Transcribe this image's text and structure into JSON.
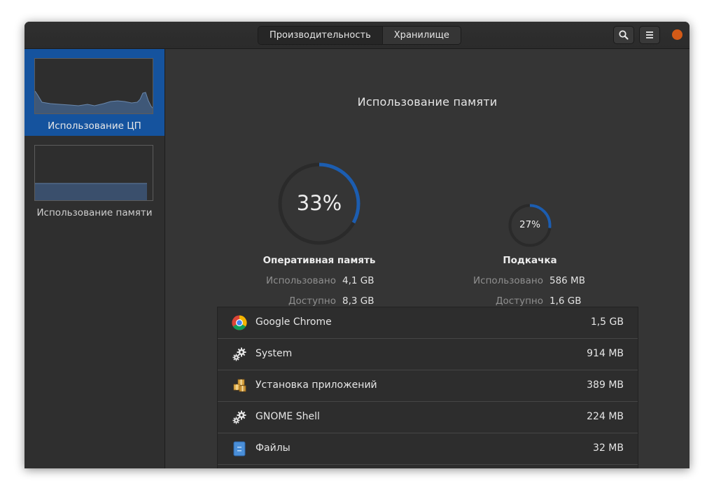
{
  "header": {
    "tabs": [
      {
        "label": "Производительность"
      },
      {
        "label": "Хранилище"
      }
    ],
    "icons": {
      "search": "search-icon",
      "menu": "hamburger-menu-icon",
      "close": "close-icon"
    },
    "close_color": "#d35a17"
  },
  "sidebar": {
    "items": [
      {
        "label": "Использование ЦП",
        "selected": true
      },
      {
        "label": "Использование памяти",
        "selected": false
      }
    ]
  },
  "main": {
    "title": "Использование памяти",
    "ram": {
      "percent_text": "33%",
      "percent": 0.33,
      "title": "Оперативная память",
      "used_label": "Использовано",
      "used_value": "4,1 GB",
      "avail_label": "Доступно",
      "avail_value": "8,3 GB"
    },
    "swap": {
      "percent_text": "27%",
      "percent": 0.27,
      "title": "Подкачка",
      "used_label": "Использовано",
      "used_value": "586 MB",
      "avail_label": "Доступно",
      "avail_value": "1,6 GB"
    },
    "processes": [
      {
        "name": "Google Chrome",
        "memory": "1,5 GB",
        "icon": "chrome-icon"
      },
      {
        "name": "System",
        "memory": "914 MB",
        "icon": "gears-icon"
      },
      {
        "name": "Установка приложений",
        "memory": "389 MB",
        "icon": "software-package-icon"
      },
      {
        "name": "GNOME Shell",
        "memory": "224 MB",
        "icon": "gears-icon"
      },
      {
        "name": "Файлы",
        "memory": "32 MB",
        "icon": "files-icon"
      }
    ]
  },
  "colors": {
    "accent": "#15539e",
    "gauge_track": "#2a2a2a",
    "gauge_fill": "#1c5db0"
  }
}
